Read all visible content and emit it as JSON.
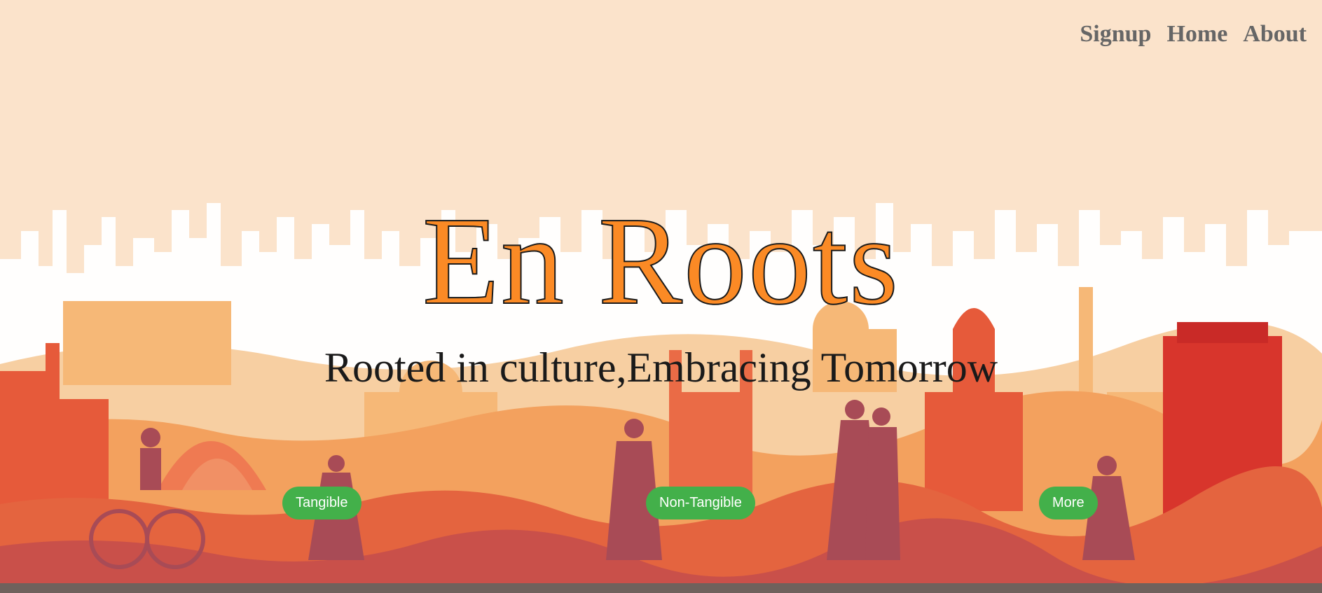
{
  "nav": {
    "items": [
      {
        "label": "Signup"
      },
      {
        "label": "Home"
      },
      {
        "label": "About"
      }
    ]
  },
  "hero": {
    "title": "En Roots",
    "subtitle": "Rooted in culture,Embracing Tomorrow"
  },
  "categories": [
    {
      "label": "Tangible"
    },
    {
      "label": "Non-Tangible"
    },
    {
      "label": "More"
    }
  ],
  "background": {
    "description_icon": "india-skyline-illustration",
    "sky_color": "#fbe3cb",
    "accent_orange": "#fb8a25",
    "button_green": "#43b04a"
  }
}
